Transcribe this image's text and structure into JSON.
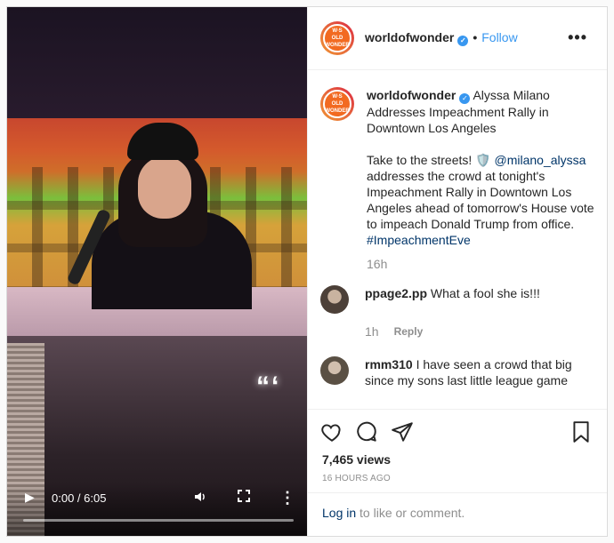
{
  "video": {
    "time": "0:00 / 6:05",
    "progress": 0.0,
    "play_icon": "play-icon",
    "volume_icon": "volume-icon",
    "fullscreen_icon": "fullscreen-icon",
    "more_icon": "more-vertical-icon"
  },
  "header": {
    "avatar_text": "W∙S OLD WONDER",
    "username": "worldofwonder",
    "separator": "•",
    "follow_label": "Follow",
    "more_label": "•••"
  },
  "caption": {
    "username": "worldofwonder",
    "title": "Alyssa Milano Addresses Impeachment Rally in Downtown Los Angeles",
    "body_before": "Take to the streets! 🛡️ ",
    "mention": "@milano_alyssa",
    "body_after": " addresses the crowd at tonight's Impeachment Rally in Downtown Los Angeles ahead of tomorrow's House vote to impeach Donald Trump from office. ",
    "hashtag": "#ImpeachmentEve",
    "time": "16h"
  },
  "comments": [
    {
      "username": "ppage2.pp",
      "text": "What a fool she is!!!",
      "time": "1h",
      "reply_label": "Reply"
    },
    {
      "username": "rmm310",
      "text": "I have seen a crowd that big since my sons last little league game"
    }
  ],
  "actions": {
    "views": "7,465 views",
    "time_ago": "16 HOURS AGO"
  },
  "login": {
    "link": "Log in",
    "rest": " to like or comment."
  },
  "colors": {
    "accent": "#3897f0",
    "link": "#003569",
    "muted": "#8e8e8e",
    "text": "#262626"
  }
}
